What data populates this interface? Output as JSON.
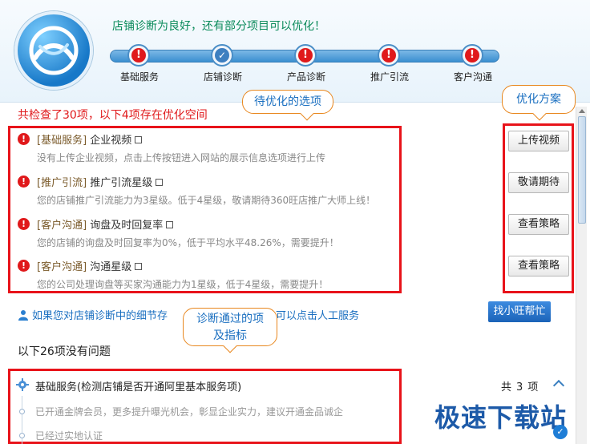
{
  "header": {
    "message": "店铺诊断为良好，还有部分项目可以优化！",
    "steps": [
      {
        "label": "基础服务",
        "status": "warning"
      },
      {
        "label": "店铺诊断",
        "status": "ok"
      },
      {
        "label": "产品诊断",
        "status": "warning"
      },
      {
        "label": "推广引流",
        "status": "warning"
      },
      {
        "label": "客户沟通",
        "status": "warning"
      }
    ],
    "step_icons": {
      "warning": "!",
      "ok": "✓"
    }
  },
  "summary": "共检查了30项，以下4项存在优化空间",
  "callouts": {
    "to_optimize": "待优化的选项",
    "plan": "优化方案",
    "passed_line1": "诊断通过的项",
    "passed_line2": "及指标"
  },
  "issues": [
    {
      "category": "[基础服务]",
      "title": "企业视频",
      "desc": "没有上传企业视频，点击上传按钮进入网站的展示信息选项进行上传",
      "action": "上传视频"
    },
    {
      "category": "[推广引流]",
      "title": "推广引流星级",
      "desc": "您的店铺推广引流能力为3星级。低于4星级，敬请期待360旺店推广大师上线！",
      "action": "敬请期待"
    },
    {
      "category": "[客户沟通]",
      "title": "询盘及时回复率",
      "desc": "您的店铺的询盘及时回复率为0%，低于平均水平48.26%，需要提升！",
      "action": "查看策略"
    },
    {
      "category": "[客户沟通]",
      "title": "沟通星级",
      "desc": "您的公司处理询盘等买家沟通能力为1星级，低于4星级，需要提升！",
      "action": "查看策略"
    }
  ],
  "help": {
    "text_before": "如果您对店铺诊断中的细节存",
    "text_after": "协助诊断，可以点击人工服务",
    "button": "找小旺帮忙"
  },
  "ok_title": "以下26项没有问题",
  "group": {
    "title": "基础服务(检测店铺是否开通阿里基本服务项)",
    "count_prefix": "共",
    "count": "3",
    "count_suffix": "项",
    "items": [
      "已开通金牌会员，更多提升曝光机会，彰显企业实力，建议开通金品诚企",
      "已经过实地认证"
    ]
  },
  "watermark": "极速下载站",
  "colors": {
    "accent": "#1a6fc0",
    "warning": "#e0191b",
    "highlight": "#e8131a",
    "callout_border": "#e8871e"
  }
}
